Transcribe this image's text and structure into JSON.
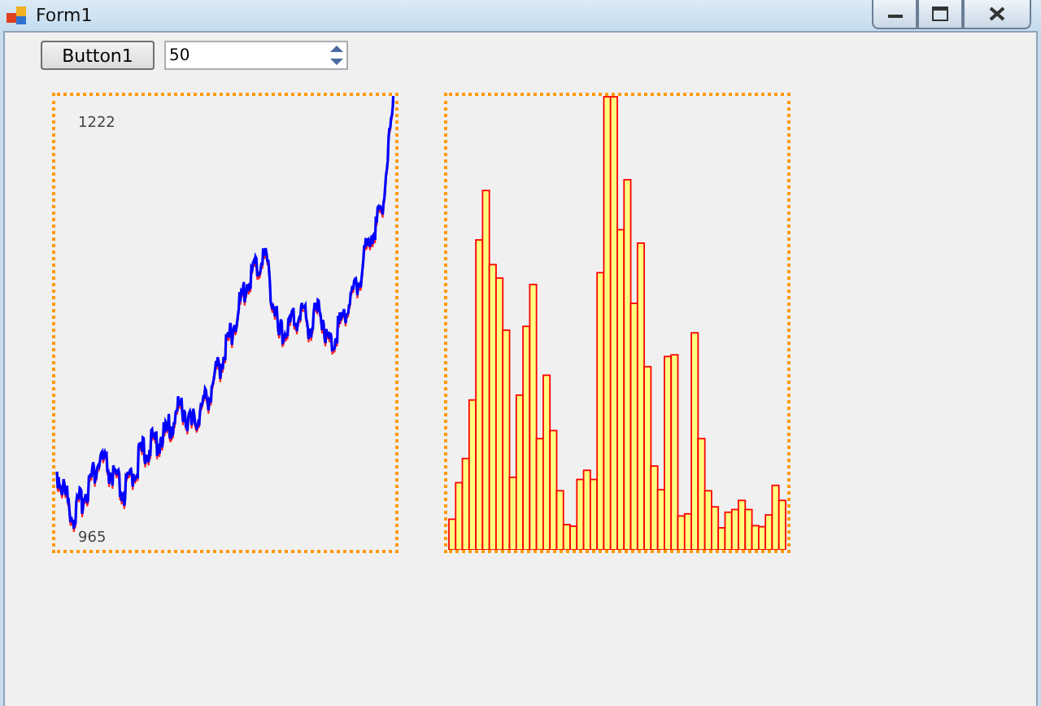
{
  "window": {
    "title": "Form1"
  },
  "toolbar": {
    "button": "Button1",
    "spinner_value": "50"
  },
  "line_plot": {
    "max_label": "1222",
    "min_label": "965"
  }
}
